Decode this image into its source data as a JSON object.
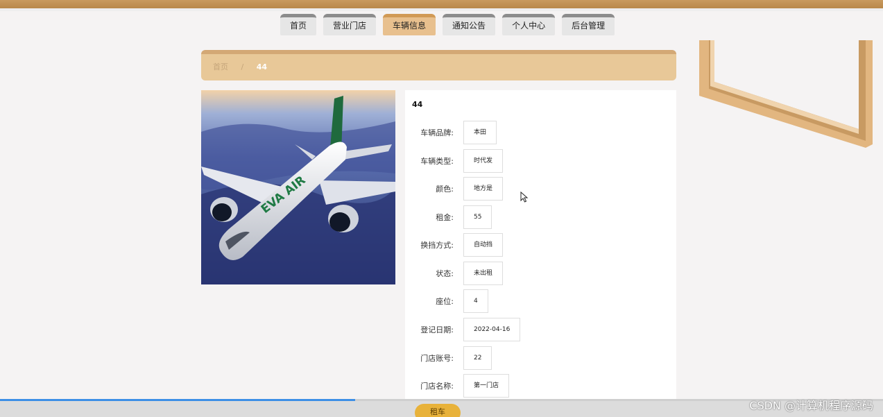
{
  "nav": {
    "items": [
      {
        "label": "首页",
        "active": false
      },
      {
        "label": "营业门店",
        "active": false
      },
      {
        "label": "车辆信息",
        "active": true
      },
      {
        "label": "通知公告",
        "active": false
      },
      {
        "label": "个人中心",
        "active": false
      },
      {
        "label": "后台管理",
        "active": false
      }
    ]
  },
  "breadcrumb": {
    "home": "首页",
    "separator": "/",
    "current": "44"
  },
  "detail": {
    "title": "44",
    "fields": [
      {
        "label": "车辆品牌:",
        "value": "本田"
      },
      {
        "label": "车辆类型:",
        "value": "时代发"
      },
      {
        "label": "颜色:",
        "value": "地方是"
      },
      {
        "label": "租金:",
        "value": "55"
      },
      {
        "label": "换挡方式:",
        "value": "自动挡"
      },
      {
        "label": "状态:",
        "value": "未出租"
      },
      {
        "label": "座位:",
        "value": "4"
      },
      {
        "label": "登记日期:",
        "value": "2022-04-16"
      },
      {
        "label": "门店账号:",
        "value": "22"
      },
      {
        "label": "门店名称:",
        "value": "第一门店"
      }
    ]
  },
  "photo": {
    "airline_text": "EVA AIR"
  },
  "footer": {
    "rent_button": "租车",
    "progress_percent": 40
  },
  "watermark": "CSDN @计算机程序源码",
  "colors": {
    "accent": "#e8c898",
    "nav_active": "#e8c08e",
    "progress": "#3d8fe6",
    "button": "#e8b23a"
  }
}
